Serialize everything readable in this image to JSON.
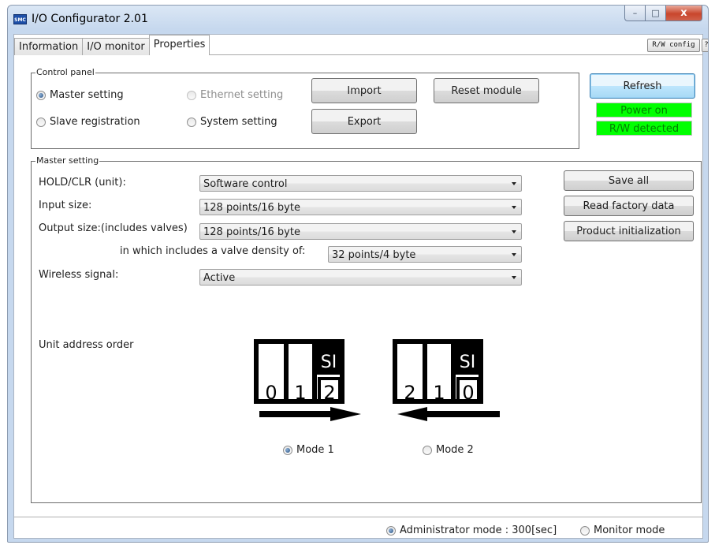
{
  "window": {
    "title": "I/O Configurator 2.01",
    "icon_text": "SMC",
    "buttons": {
      "minimize": "–",
      "maximize": "□",
      "close": "x"
    }
  },
  "tabs": [
    {
      "label": "Information",
      "active": false
    },
    {
      "label": "I/O monitor",
      "active": false
    },
    {
      "label": "Properties",
      "active": true
    }
  ],
  "top_buttons": {
    "rw_config": "R/W config",
    "help": "?"
  },
  "control_panel": {
    "label": "Control panel",
    "radios": {
      "master_setting": {
        "label": "Master setting",
        "checked": true
      },
      "ethernet_setting": {
        "label": "Ethernet setting",
        "disabled": true
      },
      "slave_registration": {
        "label": "Slave registration"
      },
      "system_setting": {
        "label": "System setting"
      }
    },
    "import_label": "Import",
    "export_label": "Export",
    "reset_label": "Reset module",
    "refresh_label": "Refresh",
    "status_power": "Power on",
    "status_rw": "R/W detected",
    "status_color": "#00ff00",
    "status_text_color": "#008000"
  },
  "master_setting": {
    "label": "Master setting",
    "hold_clr": {
      "label": "HOLD/CLR (unit):",
      "value": "Software control"
    },
    "input_size": {
      "label": "Input size:",
      "value": "128 points/16 byte"
    },
    "output_size": {
      "label": "Output size:(includes valves)",
      "value": "128 points/16 byte"
    },
    "valve_density": {
      "label": "in which includes a valve density of:",
      "value": "32 points/4 byte"
    },
    "wireless": {
      "label": "Wireless signal:",
      "value": "Active"
    },
    "save_all_label": "Save all",
    "read_factory_label": "Read factory data",
    "product_init_label": "Product initialization",
    "unit_address_label": "Unit address order",
    "mode1": {
      "label": "Mode 1",
      "checked": true,
      "si": "SI",
      "slots": [
        "0",
        "1",
        "2"
      ],
      "arrow": "right"
    },
    "mode2": {
      "label": "Mode 2",
      "checked": false,
      "si": "SI",
      "slots": [
        "2",
        "1",
        "0"
      ],
      "arrow": "left"
    }
  },
  "footer": {
    "admin_mode": {
      "label": "Administrator mode : 300[sec]",
      "checked": true
    },
    "monitor_mode": {
      "label": "Monitor mode",
      "checked": false
    }
  }
}
